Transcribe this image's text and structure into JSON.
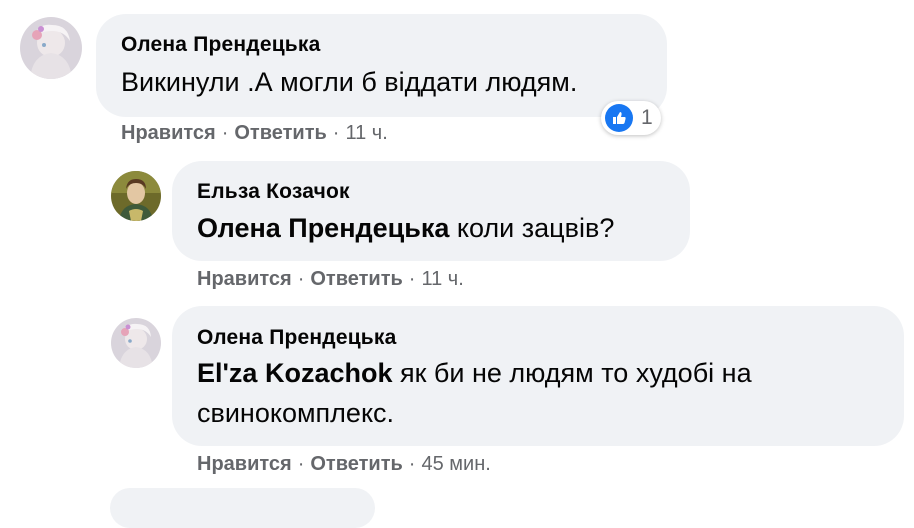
{
  "comments": [
    {
      "author": "Олена Прендецька",
      "text": "Викинули .А могли б віддати людям.",
      "like_label": "Нравится",
      "reply_label": "Ответить",
      "time": "11 ч.",
      "reaction_count": "1"
    },
    {
      "author": "Ельза Козачок",
      "mention": "Олена Прендецька",
      "text": " коли зацвів?",
      "like_label": "Нравится",
      "reply_label": "Ответить",
      "time": "11 ч."
    },
    {
      "author": "Олена Прендецька",
      "mention": "El'za Kozachok",
      "text_line1": " як би не людям то худобі на",
      "text_line2": "свинокомплекс.",
      "like_label": "Нравится",
      "reply_label": "Ответить",
      "time": "45 мин."
    }
  ],
  "colors": {
    "bubble": "#f0f2f5",
    "secondary_text": "#65676b",
    "like_blue": "#1877f2"
  }
}
